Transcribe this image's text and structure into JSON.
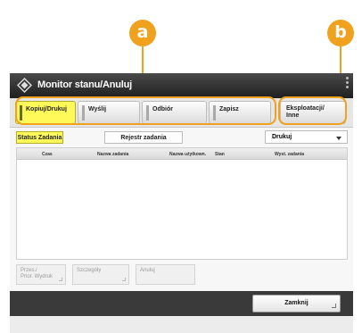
{
  "callouts": {
    "a": "a",
    "b": "b"
  },
  "window": {
    "title": "Monitor stanu/Anuluj",
    "title_icon": "monitor-status-icon"
  },
  "tabs": [
    {
      "label": "Kopiuj/Drukuj"
    },
    {
      "label": "Wyślij"
    },
    {
      "label": "Odbiór"
    },
    {
      "label": "Zapisz"
    }
  ],
  "other_tab": {
    "label": "Eksploatacji/\nInne"
  },
  "subtabs": {
    "job_status": "Status Zadania",
    "job_log": "Rejestr zadania"
  },
  "job_type_select": {
    "value": "Drukuj"
  },
  "table": {
    "headers": [
      "Czas",
      "Nazwa zadania",
      "Nazwa użytkown.",
      "Stan",
      "Wyst. zadania"
    ]
  },
  "actions": {
    "priority_print": "Przes./\nPrior. Wydruk",
    "details": "Szczegóły",
    "cancel": "Anuluj"
  },
  "close_button": "Zamknij",
  "colors": {
    "accent": "#f0a21e",
    "active_tab": "#fff95a"
  }
}
